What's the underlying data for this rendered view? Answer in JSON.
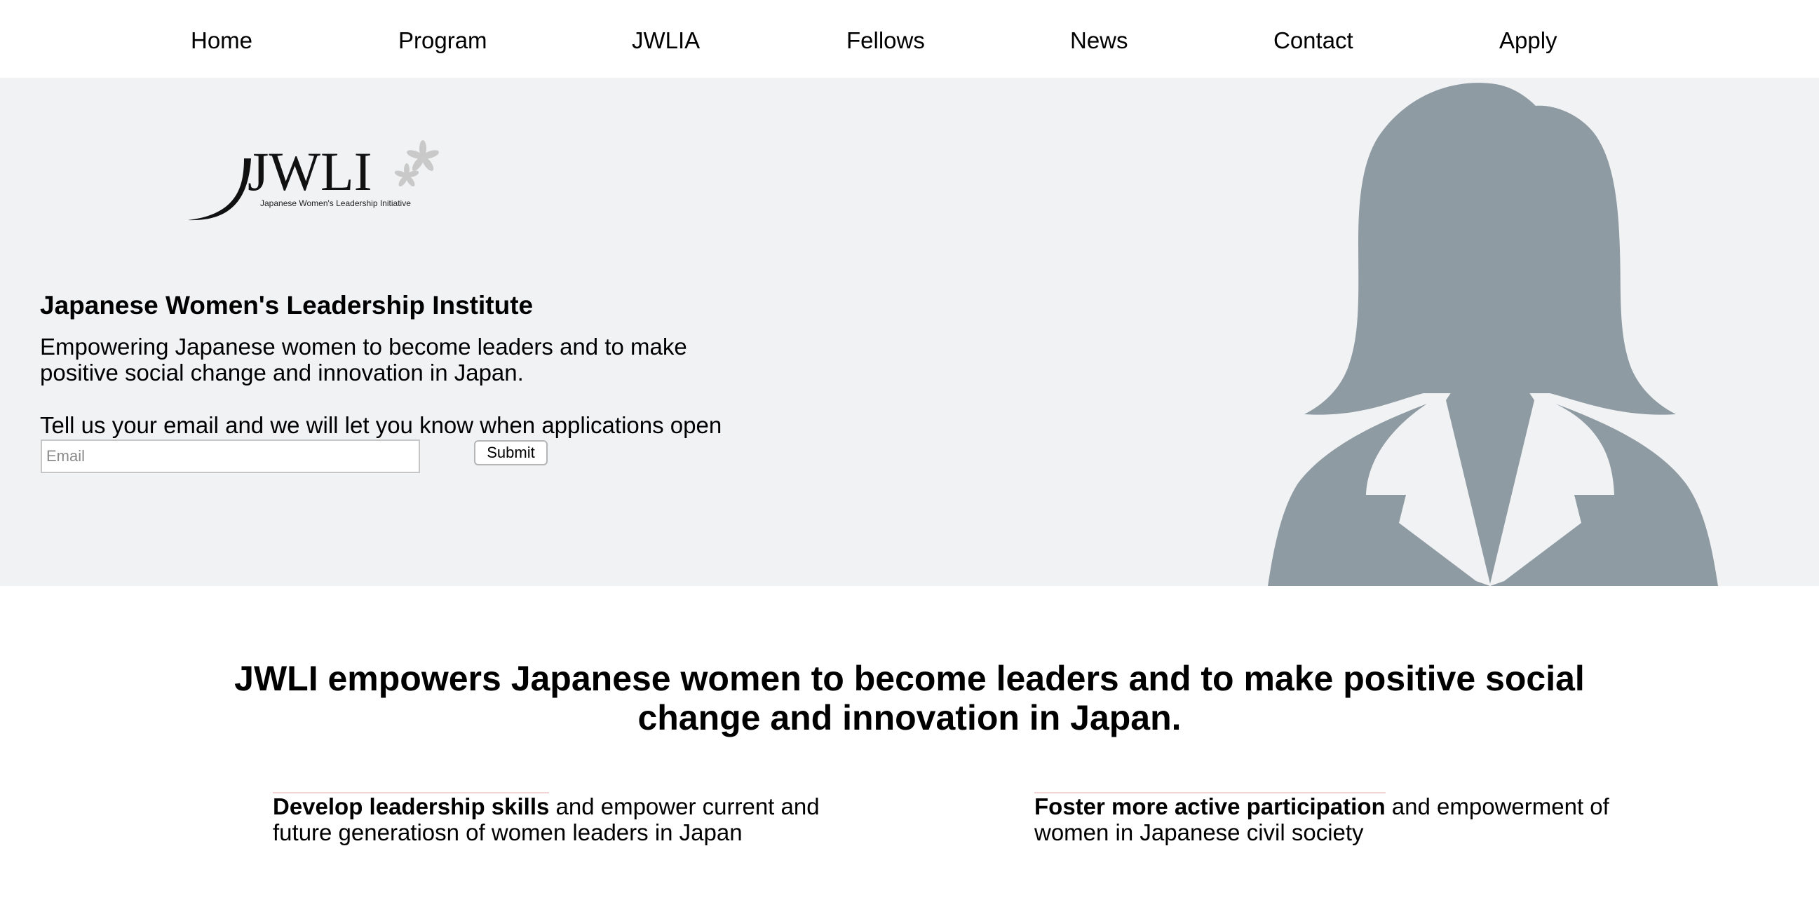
{
  "nav": {
    "items": [
      "Home",
      "Program",
      "JWLIA",
      "Fellows",
      "News",
      "Contact",
      "Apply"
    ]
  },
  "hero": {
    "logo": {
      "wordmark": "JWLI",
      "subtitle": "Japanese Women's Leadership Initiative"
    },
    "title": "Japanese Women's Leadership Institute",
    "tagline": "Empowering Japanese women to become leaders and to make positive social change and innovation in Japan.",
    "signup_text": "Tell us your email and we will let you know when applications open again!",
    "email_placeholder": "Email",
    "submit_label": "Submit",
    "background_color": "#f1f2f4",
    "silhouette_color": "#8f9ba2"
  },
  "mission": {
    "line1": "JWLI empowers Japanese women to become leaders and to make positive social",
    "line2": "change and innovation in Japan."
  },
  "features": [
    {
      "bold": "Develop leadership skills",
      "text": " and empower current and future generatiosn of women leaders in Japan"
    },
    {
      "bold": "Foster more active participation",
      "text": " and empowerment of women in Japanese civil society"
    }
  ]
}
